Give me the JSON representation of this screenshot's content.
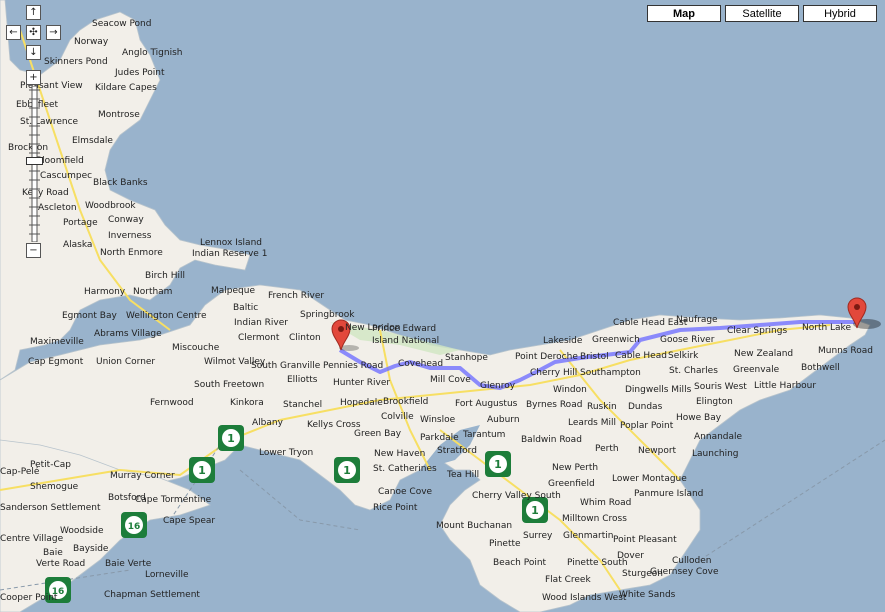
{
  "map_types": {
    "map": "Map",
    "satellite": "Satellite",
    "hybrid": "Hybrid",
    "active": "map"
  },
  "controls": {
    "pan_up": "↑",
    "pan_left": "←",
    "pan_center": "✣",
    "pan_right": "→",
    "pan_down": "↓",
    "zoom_in": "+",
    "zoom_out": "−",
    "zoom_level_fraction": 0.48
  },
  "colors": {
    "water": "#99b3cc",
    "land": "#f2efe9",
    "route": "#7070ff",
    "marker": "#e2483b",
    "highway_shield": "#1d7d3a",
    "park": "#cfe6c2",
    "road_major": "#f7df63"
  },
  "markers": [
    {
      "name": "start-marker"
    },
    {
      "name": "end-marker"
    }
  ],
  "shields": [
    "1",
    "1",
    "1",
    "1",
    "16",
    "16"
  ],
  "place_labels": [
    "Seacow Pond",
    "Norway",
    "Anglo Tignish",
    "Skinners Pond",
    "Judes Point",
    "Kildare Capes",
    "Pleasant View",
    "Ebbsfleet",
    "Montrose",
    "St. Lawrence",
    "Elmsdale",
    "Brockton",
    "Bloomfield",
    "Cascumpec",
    "Black Banks",
    "Kelly Road",
    "Woodbrook",
    "Ascleton",
    "Portage",
    "Conway",
    "Alaska",
    "Inverness",
    "Lennox Island",
    "Indian Reserve 1",
    "North Enmore",
    "Birch Hill",
    "Harmony",
    "Northam",
    "Egmont Bay",
    "Wellington Centre",
    "Abrams Village",
    "Maximeville",
    "Miscouche",
    "Cap Egmont",
    "Union Corner",
    "Wilmot Valley",
    "Malpeque",
    "French River",
    "Baltic",
    "Indian River",
    "Springbrook",
    "Clermont",
    "Clinton",
    "New London",
    "Prince Edward",
    "Island National",
    "Stanhope",
    "South Granville",
    "Pennies Road",
    "Covehead",
    "South Freetown",
    "Elliotts",
    "Hunter River",
    "Mill Cove",
    "Glenroy",
    "Fernwood",
    "Kinkora",
    "Stanchel",
    "Hopedale",
    "Brookfield",
    "Fort Augustus",
    "Albany",
    "Kellys Cross",
    "Colville",
    "Winsloe",
    "Green Bay",
    "Parkdale",
    "Tarantum",
    "Lower Tryon",
    "New Haven",
    "Stratford",
    "St. Catherines",
    "Canoe Cove",
    "Rice Point",
    "Cap-Pelé",
    "Petit-Cap",
    "Shemogue",
    "Murray Corner",
    "Cape Tormentine",
    "Botsford",
    "Cape Spear",
    "Sanderson Settlement",
    "Woodside",
    "Bayside",
    "Centre Village",
    "Baie",
    "Verte Road",
    "Baie Verte",
    "Lorneville",
    "Chapman Settlement",
    "Cooper Point",
    "Lakeside",
    "Point Deroche",
    "Bristol",
    "Cherry Hill",
    "Southampton",
    "Cable Head",
    "Cable Head East",
    "Greenwich",
    "Naufrage",
    "Goose River",
    "Clear Springs",
    "North Lake",
    "Munns Road",
    "New Zealand",
    "Bothwell",
    "Selkirk",
    "St. Charles",
    "Greenvale",
    "Souris West",
    "Little Harbour",
    "Dingwells Mills",
    "Elington",
    "Windon",
    "Byrnes Road",
    "Ruskin",
    "Dundas",
    "Howe Bay",
    "Auburn",
    "Leards Mill",
    "Poplar Point",
    "Annandale",
    "Baldwin Road",
    "Perth",
    "Newport",
    "Launching",
    "Tea Hill",
    "New Perth",
    "Lower Montague",
    "Greenfield",
    "Whim Road",
    "Panmure Island",
    "Cherry Valley South",
    "Milltown Cross",
    "Mount Buchanan",
    "Surrey",
    "Glenmartin",
    "Point Pleasant",
    "Pinette",
    "Dover",
    "Beach Point",
    "Pinette South",
    "Culloden",
    "Guernsey Cove",
    "Sturgeon",
    "Flat Creek",
    "White Sands",
    "Wood Islands West"
  ]
}
